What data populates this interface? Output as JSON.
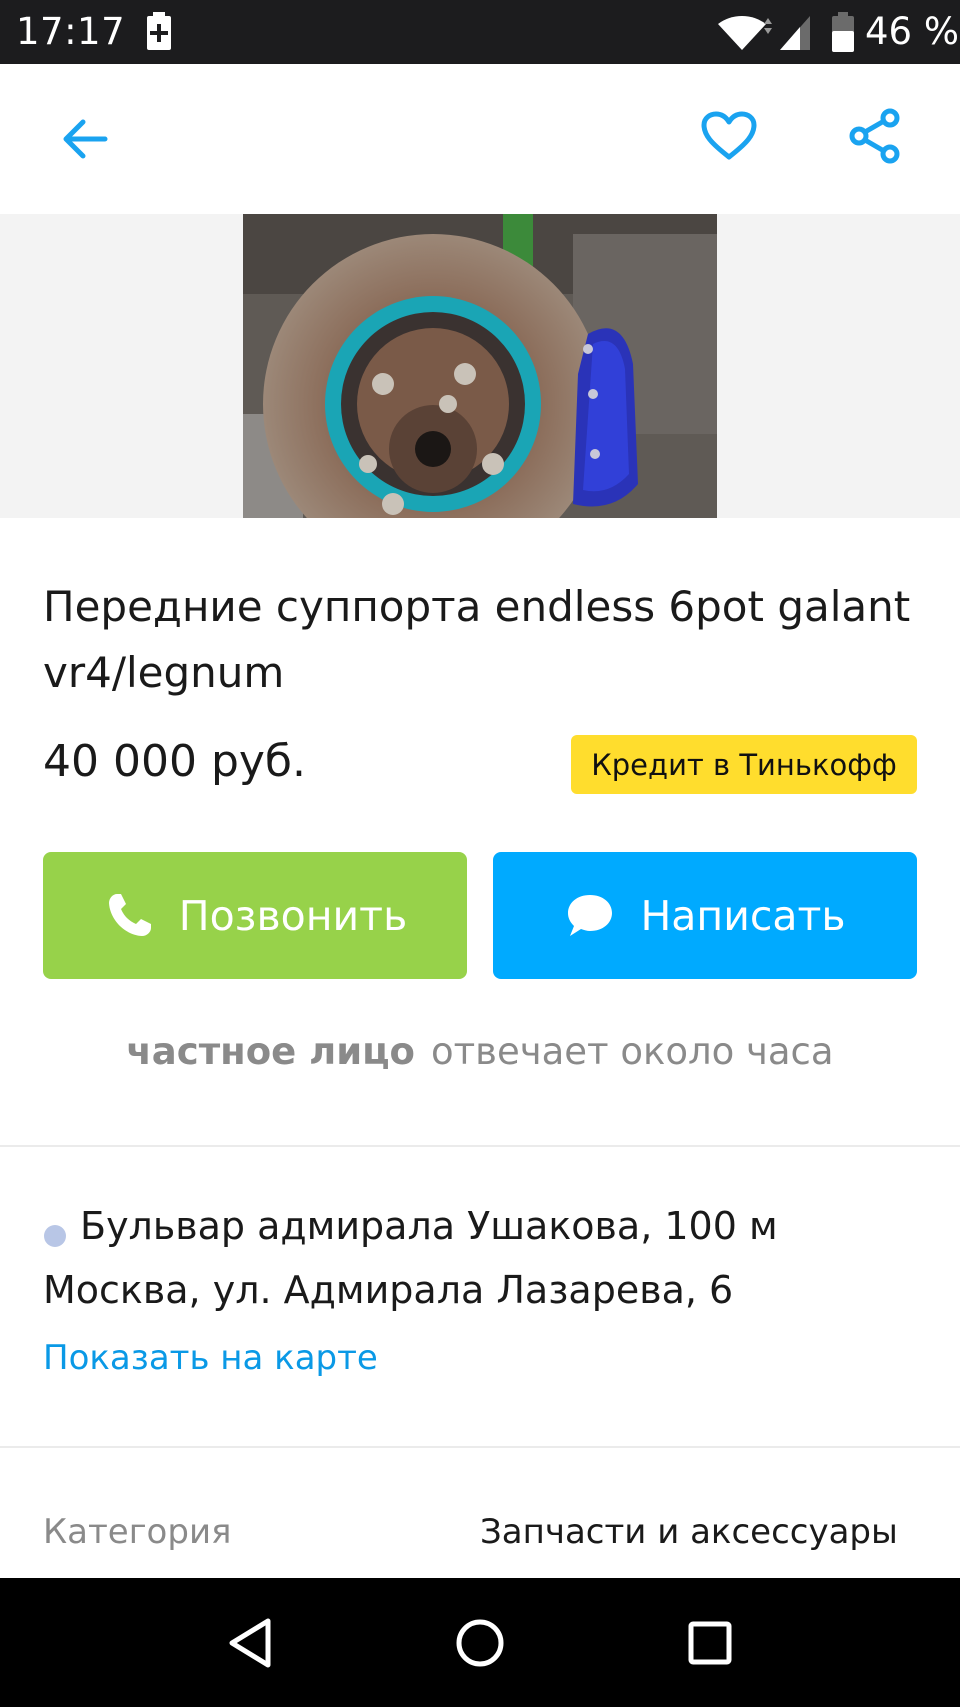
{
  "status_bar": {
    "time": "17:17",
    "battery_percent": "46 %",
    "icons": [
      "battery-saver-icon",
      "wifi-icon",
      "cellular-signal-icon",
      "battery-icon"
    ]
  },
  "app_bar": {
    "icons": [
      "back-arrow-icon",
      "heart-icon",
      "share-icon"
    ],
    "accent_color": "#1aa3f0"
  },
  "listing": {
    "title": "Передние суппорта endless 6pot galant vr4/legnum",
    "price": "40 000 руб.",
    "credit_label": "Кредит в Тинькофф",
    "credit_color": "#ffdd2d"
  },
  "actions": {
    "call_label": "Позвонить",
    "call_color": "#97d24a",
    "message_label": "Написать",
    "message_color": "#00aaff"
  },
  "seller": {
    "type": "частное лицо",
    "response": "отвечает около часа"
  },
  "location": {
    "metro": "Бульвар адмирала Ушакова, 100 м",
    "address": "Москва, ул. Адмирала Лазарева, 6",
    "map_link": "Показать на карте"
  },
  "params": {
    "category_label": "Категория",
    "category_value": "Запчасти и аксессуары"
  },
  "nav_bar": {
    "icons": [
      "nav-back-icon",
      "nav-home-icon",
      "nav-recents-icon"
    ]
  }
}
